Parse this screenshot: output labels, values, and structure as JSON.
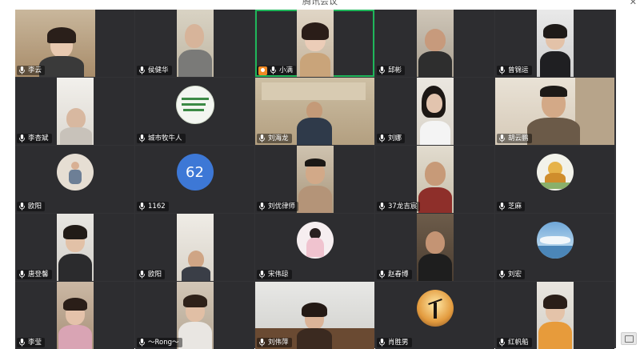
{
  "app": {
    "title": "腾讯会议",
    "close_glyph": "✕"
  },
  "colors": {
    "active_border": "#1fb65a",
    "tile_bg": "#2d2d30",
    "grid_bg": "#333336",
    "number_avatar": "#3d78d6"
  },
  "participants": [
    {
      "name": "李云"
    },
    {
      "name": "侯健华"
    },
    {
      "name": "小满"
    },
    {
      "name": "邱彬"
    },
    {
      "name": "曾锦运"
    },
    {
      "name": "李杏斌"
    },
    {
      "name": "城市牧牛人"
    },
    {
      "name": "刘海龙"
    },
    {
      "name": "刘娜"
    },
    {
      "name": "胡云鹏"
    },
    {
      "name": "欧阳"
    },
    {
      "name": "1162",
      "avatar_text": "62"
    },
    {
      "name": "刘优律师"
    },
    {
      "name": "37龙吉宸"
    },
    {
      "name": "芝麻"
    },
    {
      "name": "唐登馨"
    },
    {
      "name": "欧阳"
    },
    {
      "name": "宋伟琼"
    },
    {
      "name": "赵春博"
    },
    {
      "name": "刘宏"
    },
    {
      "name": "李莹"
    },
    {
      "name": "～Rong～"
    },
    {
      "name": "刘伟萍"
    },
    {
      "name": "肖胜男"
    },
    {
      "name": "红帆船"
    }
  ]
}
